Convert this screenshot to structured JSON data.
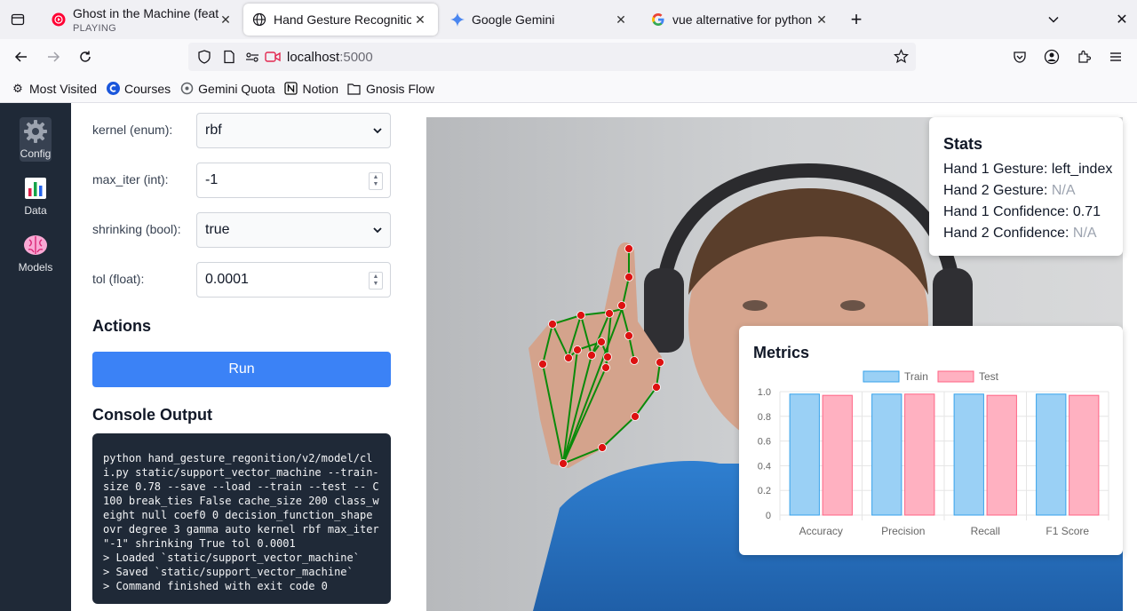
{
  "browser": {
    "tabs": [
      {
        "label": "Ghost in the Machine (feat",
        "sublabel": "PLAYING",
        "icon": "youtube-music-icon"
      },
      {
        "label": "Hand Gesture Recognition",
        "icon": "globe-icon"
      },
      {
        "label": "Google Gemini",
        "icon": "gemini-icon"
      },
      {
        "label": "vue alternative for python",
        "icon": "google-icon"
      }
    ],
    "url_host": "localhost",
    "url_port": ":5000",
    "bookmarks": [
      {
        "label": "Most Visited",
        "icon": "gear-icon"
      },
      {
        "label": "Courses",
        "icon": "courses-icon"
      },
      {
        "label": "Gemini Quota",
        "icon": "gemini-quota-icon"
      },
      {
        "label": "Notion",
        "icon": "notion-icon"
      },
      {
        "label": "Gnosis Flow",
        "icon": "folder-icon"
      }
    ]
  },
  "sidebar": {
    "items": [
      {
        "label": "Config",
        "icon": "gear-icon",
        "active": true
      },
      {
        "label": "Data",
        "icon": "bar-chart-icon"
      },
      {
        "label": "Models",
        "icon": "brain-icon"
      }
    ]
  },
  "config": {
    "fields": [
      {
        "label": "kernel (enum):",
        "value": "rbf",
        "type": "select"
      },
      {
        "label": "max_iter (int):",
        "value": "-1",
        "type": "number"
      },
      {
        "label": "shrinking (bool):",
        "value": "true",
        "type": "select"
      },
      {
        "label": "tol (float):",
        "value": "0.0001",
        "type": "number"
      }
    ],
    "actions_title": "Actions",
    "run_label": "Run",
    "console_title": "Console Output",
    "console_text": "python hand_gesture_regonition/v2/model/cli.py static/support_vector_machine --train-size 0.78 --save --load --train --test -- C 100 break_ties False cache_size 200 class_weight null coef0 0 decision_function_shape ovr degree 3 gamma auto kernel rbf max_iter \"-1\" shrinking True tol 0.0001\n> Loaded `static/support_vector_machine`\n> Saved `static/support_vector_machine`\n> Command finished with exit code 0"
  },
  "stats": {
    "title": "Stats",
    "lines": [
      {
        "label": "Hand 1 Gesture:",
        "value": "left_index",
        "muted": false
      },
      {
        "label": "Hand 2 Gesture:",
        "value": "N/A",
        "muted": true
      },
      {
        "label": "Hand 1 Confidence:",
        "value": "0.71",
        "muted": false
      },
      {
        "label": "Hand 2 Confidence:",
        "value": "N/A",
        "muted": true
      }
    ]
  },
  "metrics": {
    "title": "Metrics"
  },
  "chart_data": {
    "type": "bar",
    "categories": [
      "Accuracy",
      "Precision",
      "Recall",
      "F1 Score"
    ],
    "series": [
      {
        "name": "Train",
        "values": [
          0.98,
          0.98,
          0.98,
          0.98
        ],
        "color": "#9ad0f5",
        "border": "#36a2eb"
      },
      {
        "name": "Test",
        "values": [
          0.97,
          0.98,
          0.97,
          0.97
        ],
        "color": "#ffb1c1",
        "border": "#ff6384"
      }
    ],
    "yticks": [
      "0",
      "0.2",
      "0.4",
      "0.6",
      "0.8",
      "1.0"
    ],
    "ylim": [
      0,
      1.0
    ],
    "legend": "top",
    "grid": true
  },
  "colors": {
    "sidebar_bg": "#1f2937",
    "run_button": "#3b82f6",
    "console_bg": "#1f2937",
    "hand_line": "#0a8a0a",
    "hand_point": "#dd1111"
  }
}
